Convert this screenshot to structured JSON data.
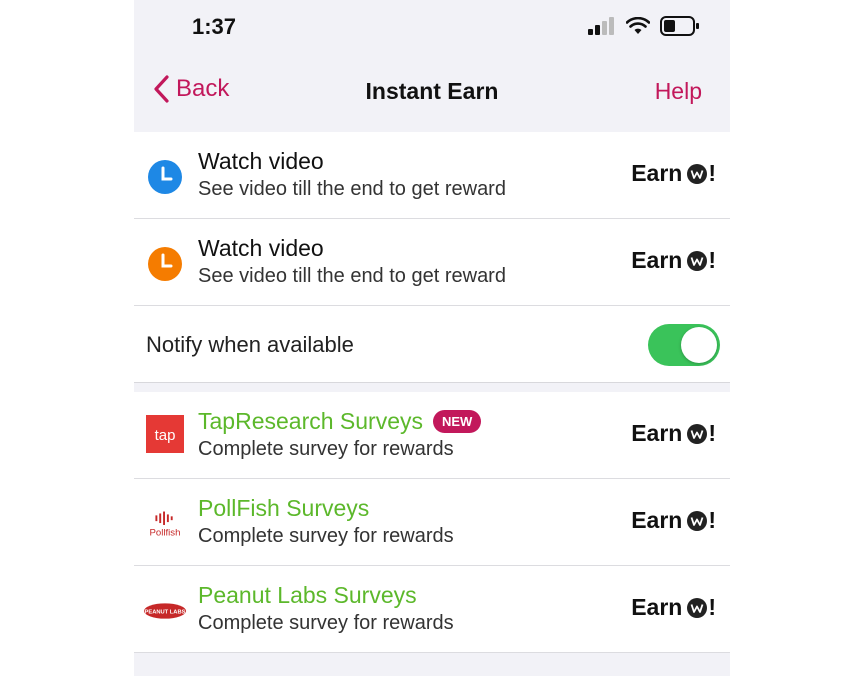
{
  "status": {
    "time": "1:37"
  },
  "nav": {
    "back_label": "Back",
    "title": "Instant Earn",
    "help_label": "Help"
  },
  "videos": [
    {
      "title": "Watch video",
      "subtitle": "See video till the end to get reward",
      "earn_label": "Earn",
      "icon": "clock-icon",
      "color": "#1e88e5"
    },
    {
      "title": "Watch video",
      "subtitle": "See video till the end to get reward",
      "earn_label": "Earn",
      "icon": "clock-icon",
      "color": "#f57c00"
    }
  ],
  "notify": {
    "label": "Notify when available",
    "enabled": true
  },
  "surveys": [
    {
      "title": "TapResearch Surveys",
      "badge": "NEW",
      "subtitle": "Complete survey for rewards",
      "earn_label": "Earn",
      "logo_text": "tap"
    },
    {
      "title": "PollFish Surveys",
      "subtitle": "Complete survey for rewards",
      "earn_label": "Earn",
      "logo_text": "Pollfish"
    },
    {
      "title": "Peanut Labs Surveys",
      "subtitle": "Complete survey for rewards",
      "earn_label": "Earn",
      "logo_text": "PEANUT LABS"
    }
  ],
  "colors": {
    "accent": "#c2185b",
    "survey_title": "#5cb82b",
    "toggle_on": "#3ac35a"
  }
}
